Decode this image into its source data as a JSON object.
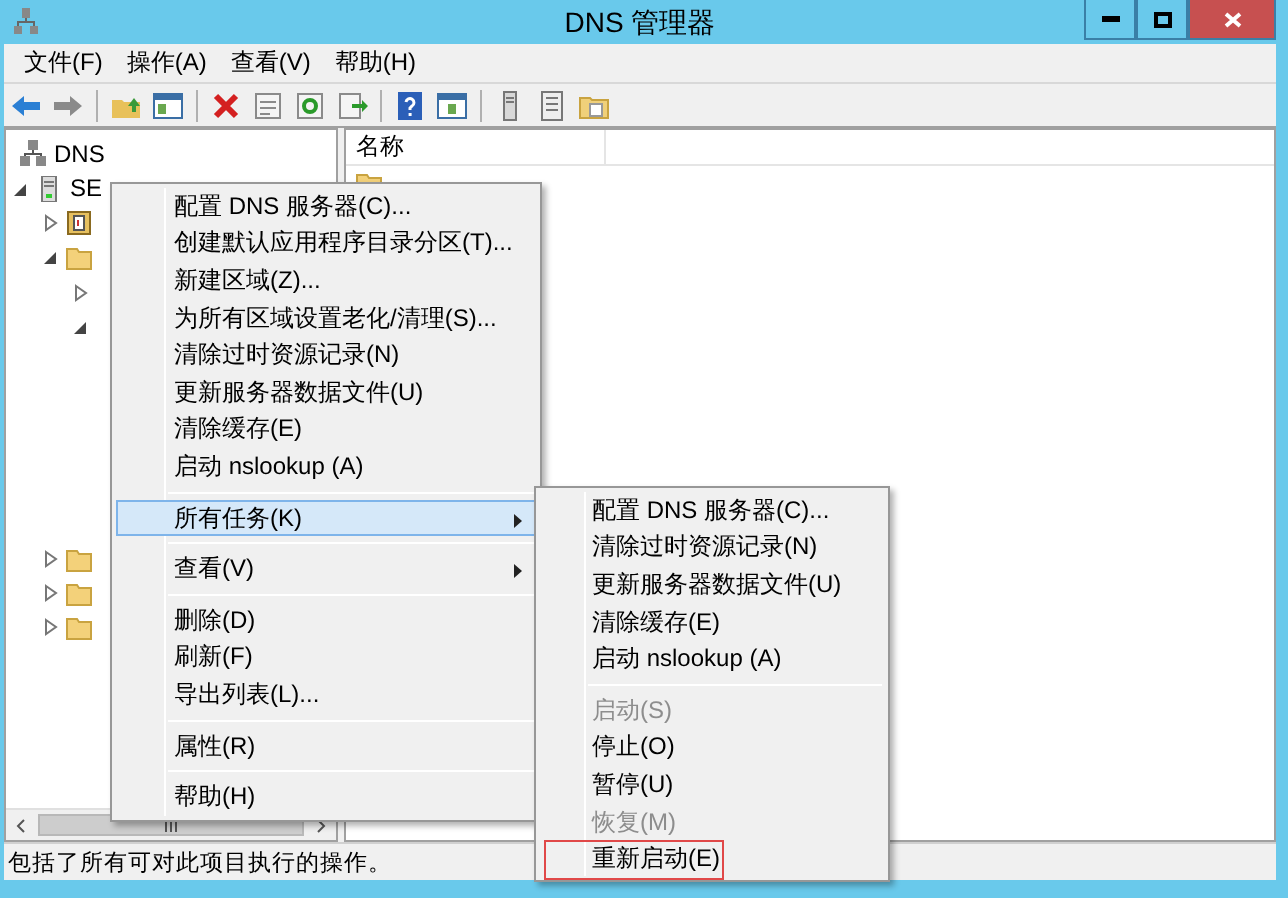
{
  "window": {
    "title": "DNS 管理器"
  },
  "menu_bar": [
    {
      "label": "文件(F)"
    },
    {
      "label": "操作(A)"
    },
    {
      "label": "查看(V)"
    },
    {
      "label": "帮助(H)"
    }
  ],
  "tree": [
    {
      "label": "DNS",
      "kind": "dns",
      "children": [
        {
          "label": "SE",
          "kind": "server",
          "expanded": true,
          "children": [
            {
              "kind": "log",
              "expanded": false
            },
            {
              "kind": "folder",
              "expanded": true,
              "children": [
                {
                  "expanded": false
                },
                {
                  "expanded": true
                }
              ]
            },
            {
              "kind": "folder",
              "expanded": false
            },
            {
              "kind": "folder",
              "expanded": false
            },
            {
              "kind": "folder",
              "expanded": false
            }
          ]
        }
      ]
    }
  ],
  "list": {
    "column_header": "名称"
  },
  "context_menu": {
    "items": [
      {
        "kind": "item",
        "label": "配置 DNS 服务器(C)...",
        "selected": false,
        "has_submenu": false
      },
      {
        "kind": "item",
        "label": "创建默认应用程序目录分区(T)...",
        "selected": false,
        "has_submenu": false
      },
      {
        "kind": "item",
        "label": "新建区域(Z)...",
        "selected": false,
        "has_submenu": false
      },
      {
        "kind": "item",
        "label": "为所有区域设置老化/清理(S)...",
        "selected": false,
        "has_submenu": false
      },
      {
        "kind": "item",
        "label": "清除过时资源记录(N)",
        "selected": false,
        "has_submenu": false
      },
      {
        "kind": "item",
        "label": "更新服务器数据文件(U)",
        "selected": false,
        "has_submenu": false
      },
      {
        "kind": "item",
        "label": "清除缓存(E)",
        "selected": false,
        "has_submenu": false
      },
      {
        "kind": "item",
        "label": "启动 nslookup (A)",
        "selected": false,
        "has_submenu": false
      },
      {
        "kind": "separator"
      },
      {
        "kind": "item",
        "label": "所有任务(K)",
        "selected": true,
        "has_submenu": true
      },
      {
        "kind": "separator"
      },
      {
        "kind": "item",
        "label": "查看(V)",
        "selected": false,
        "has_submenu": true
      },
      {
        "kind": "separator"
      },
      {
        "kind": "item",
        "label": "删除(D)",
        "selected": false,
        "has_submenu": false
      },
      {
        "kind": "item",
        "label": "刷新(F)",
        "selected": false,
        "has_submenu": false
      },
      {
        "kind": "item",
        "label": "导出列表(L)...",
        "selected": false,
        "has_submenu": false
      },
      {
        "kind": "separator"
      },
      {
        "kind": "item",
        "label": "属性(R)",
        "selected": false,
        "has_submenu": false
      },
      {
        "kind": "separator"
      },
      {
        "kind": "item",
        "label": "帮助(H)",
        "selected": false,
        "has_submenu": false
      }
    ]
  },
  "submenu": {
    "items": [
      {
        "kind": "item",
        "label": "配置 DNS 服务器(C)...",
        "disabled": false,
        "annotated": false
      },
      {
        "kind": "item",
        "label": "清除过时资源记录(N)",
        "disabled": false,
        "annotated": false
      },
      {
        "kind": "item",
        "label": "更新服务器数据文件(U)",
        "disabled": false,
        "annotated": false
      },
      {
        "kind": "item",
        "label": "清除缓存(E)",
        "disabled": false,
        "annotated": false
      },
      {
        "kind": "item",
        "label": "启动 nslookup (A)",
        "disabled": false,
        "annotated": false
      },
      {
        "kind": "separator"
      },
      {
        "kind": "item",
        "label": "启动(S)",
        "disabled": true,
        "annotated": false
      },
      {
        "kind": "item",
        "label": "停止(O)",
        "disabled": false,
        "annotated": false
      },
      {
        "kind": "item",
        "label": "暂停(U)",
        "disabled": false,
        "annotated": false
      },
      {
        "kind": "item",
        "label": "恢复(M)",
        "disabled": true,
        "annotated": false
      },
      {
        "kind": "item",
        "label": "重新启动(E)",
        "disabled": false,
        "annotated": true
      }
    ]
  },
  "status_bar": {
    "text": "包括了所有可对此项目执行的操作。"
  }
}
